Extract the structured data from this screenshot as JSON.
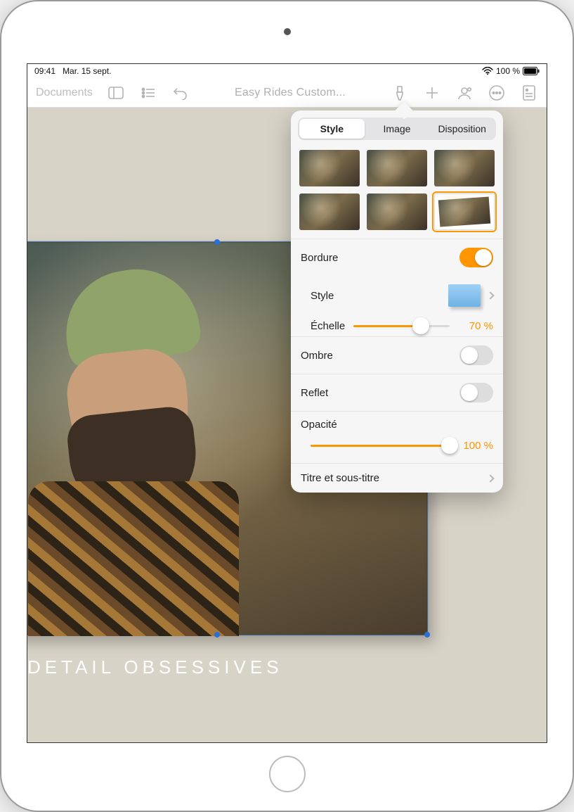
{
  "status": {
    "time": "09:41",
    "date": "Mar. 15 sept.",
    "battery": "100 %"
  },
  "toolbar": {
    "documents": "Documents",
    "title": "Easy Rides Custom..."
  },
  "canvas": {
    "caption": "DETAIL OBSESSIVES"
  },
  "popover": {
    "tabs": {
      "style": "Style",
      "image": "Image",
      "disposition": "Disposition"
    },
    "bordure_label": "Bordure",
    "bordure_on": true,
    "style_label": "Style",
    "echelle_label": "Échelle",
    "echelle_value": "70 %",
    "echelle_pct": 70,
    "ombre_label": "Ombre",
    "ombre_on": false,
    "reflet_label": "Reflet",
    "reflet_on": false,
    "opacite_label": "Opacité",
    "opacite_value": "100 %",
    "opacite_pct": 100,
    "titre_label": "Titre et sous-titre"
  }
}
